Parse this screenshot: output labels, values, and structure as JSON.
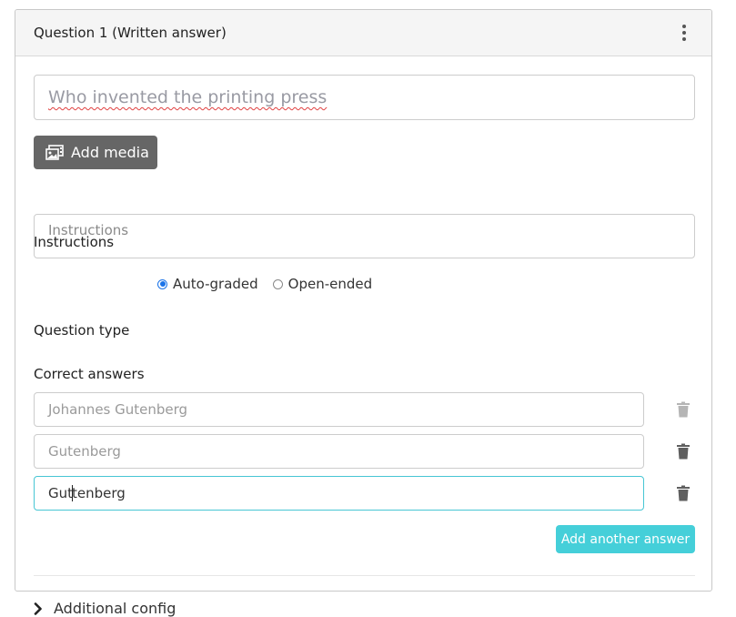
{
  "card": {
    "title": "Question 1 (Written answer)",
    "menu_icon": "kebab-menu-icon"
  },
  "question": {
    "value": "Who invented the printing press"
  },
  "media_button": {
    "label": "Add media",
    "icon": "photo-film-icon"
  },
  "instructions": {
    "label": "Instructions",
    "placeholder": "Instructions"
  },
  "question_type": {
    "label": "Question type",
    "options": [
      {
        "label": "Auto-graded",
        "selected": true
      },
      {
        "label": "Open-ended",
        "selected": false
      }
    ],
    "accent_color": "#1a73e8"
  },
  "correct_answers": {
    "label": "Correct answers",
    "items": [
      {
        "value": "Johannes Gutenberg",
        "delete_enabled": false
      },
      {
        "value": "Gutenberg",
        "delete_enabled": true
      },
      {
        "value_before_caret": "Gut",
        "value_after_caret": "tenberg",
        "value": "Guttenberg",
        "focused": true,
        "delete_enabled": true
      }
    ],
    "add_button_label": "Add another answer",
    "add_button_color": "#45cfd9"
  },
  "additional_config": {
    "label": "Additional config",
    "icon": "chevron-right-icon"
  }
}
